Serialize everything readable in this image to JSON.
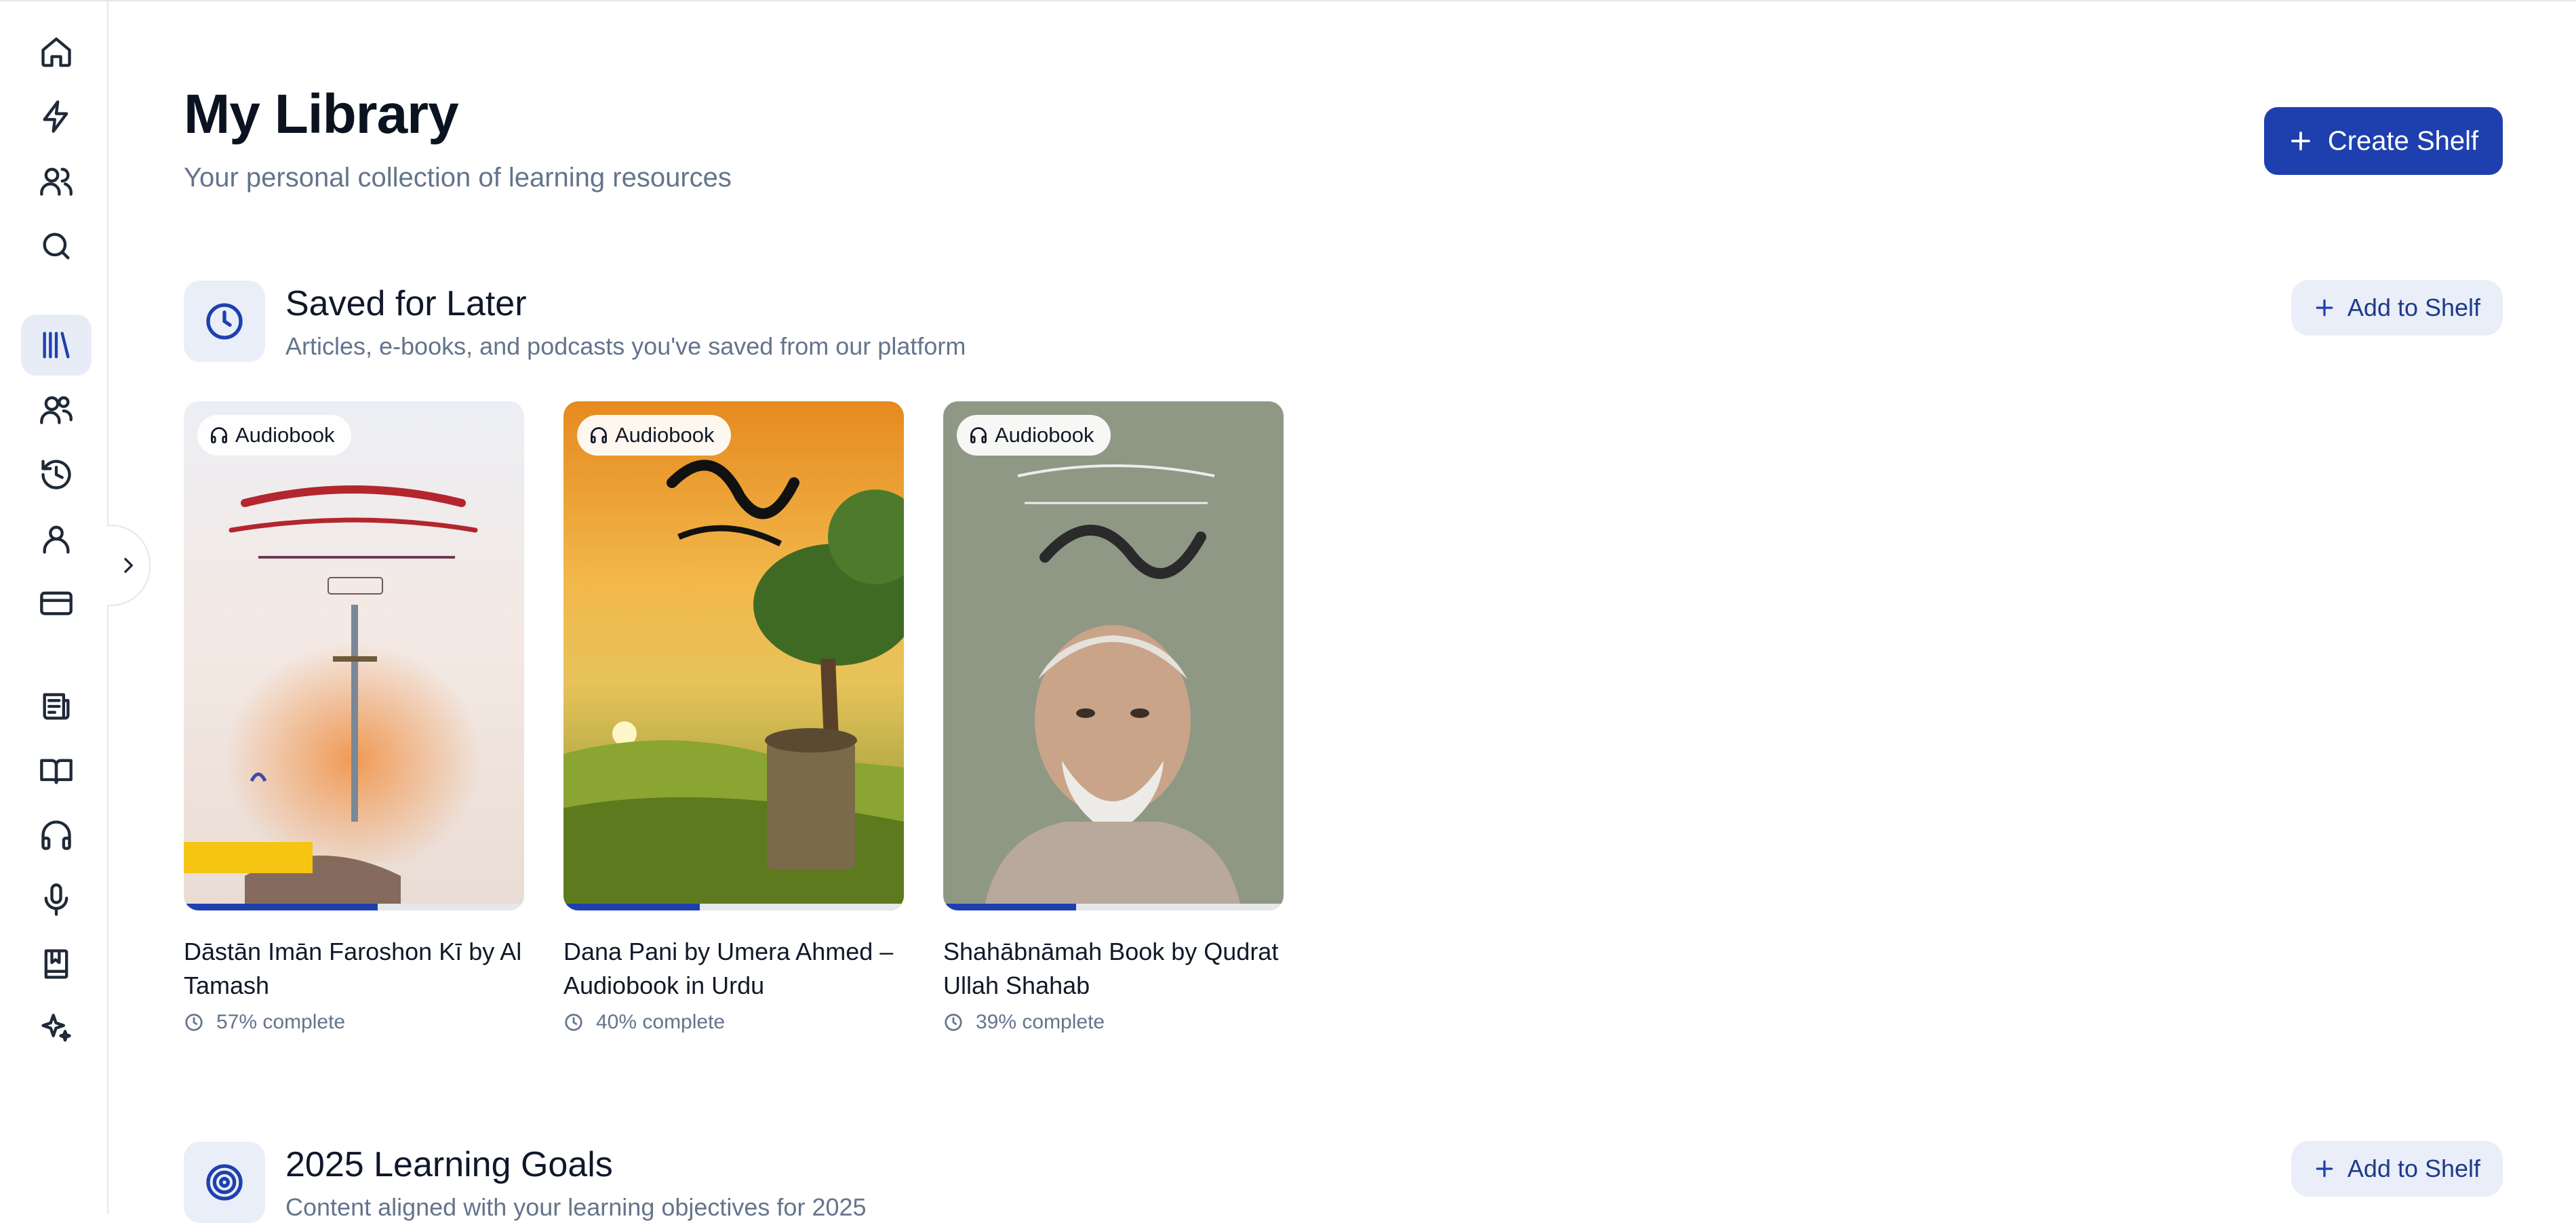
{
  "header": {
    "title": "My Library",
    "subtitle": "Your personal collection of learning resources",
    "create_shelf_label": "Create Shelf"
  },
  "sidebar": {
    "items": [
      {
        "icon": "home-icon"
      },
      {
        "icon": "lightning-icon"
      },
      {
        "icon": "users-icon"
      },
      {
        "icon": "search-icon"
      },
      {
        "icon": "library-icon",
        "active": true
      },
      {
        "icon": "community-icon"
      },
      {
        "icon": "history-icon"
      },
      {
        "icon": "profile-icon"
      },
      {
        "icon": "credit-card-icon"
      },
      {
        "icon": "newspaper-icon"
      },
      {
        "icon": "book-open-icon"
      },
      {
        "icon": "headphones-icon"
      },
      {
        "icon": "microphone-icon"
      },
      {
        "icon": "notebook-icon"
      },
      {
        "icon": "sparkles-icon"
      }
    ],
    "expand_icon": "chevron-right-icon"
  },
  "sections": [
    {
      "title": "Saved for Later",
      "description": "Articles, e-books, and podcasts you've saved from our platform",
      "add_label": "Add to Shelf",
      "icon": "clock-icon",
      "items": [
        {
          "type": "Audiobook",
          "title": "Dāstān Imān Faroshon Kī by Al Tamash",
          "progress_text": "57% complete",
          "progress": 57
        },
        {
          "type": "Audiobook",
          "title": "Dana Pani by Umera Ahmed – Audiobook in Urdu",
          "progress_text": "40% complete",
          "progress": 40
        },
        {
          "type": "Audiobook",
          "title": "Shahābnāmah Book by Qudrat Ullah Shahab",
          "progress_text": "39% complete",
          "progress": 39
        }
      ]
    },
    {
      "title": "2025 Learning Goals",
      "description": "Content aligned with your learning objectives for 2025",
      "add_label": "Add to Shelf",
      "icon": "target-icon"
    }
  ],
  "colors": {
    "accent": "#1e40af",
    "accent_soft": "#e9eef8",
    "muted_text": "#64748b"
  }
}
